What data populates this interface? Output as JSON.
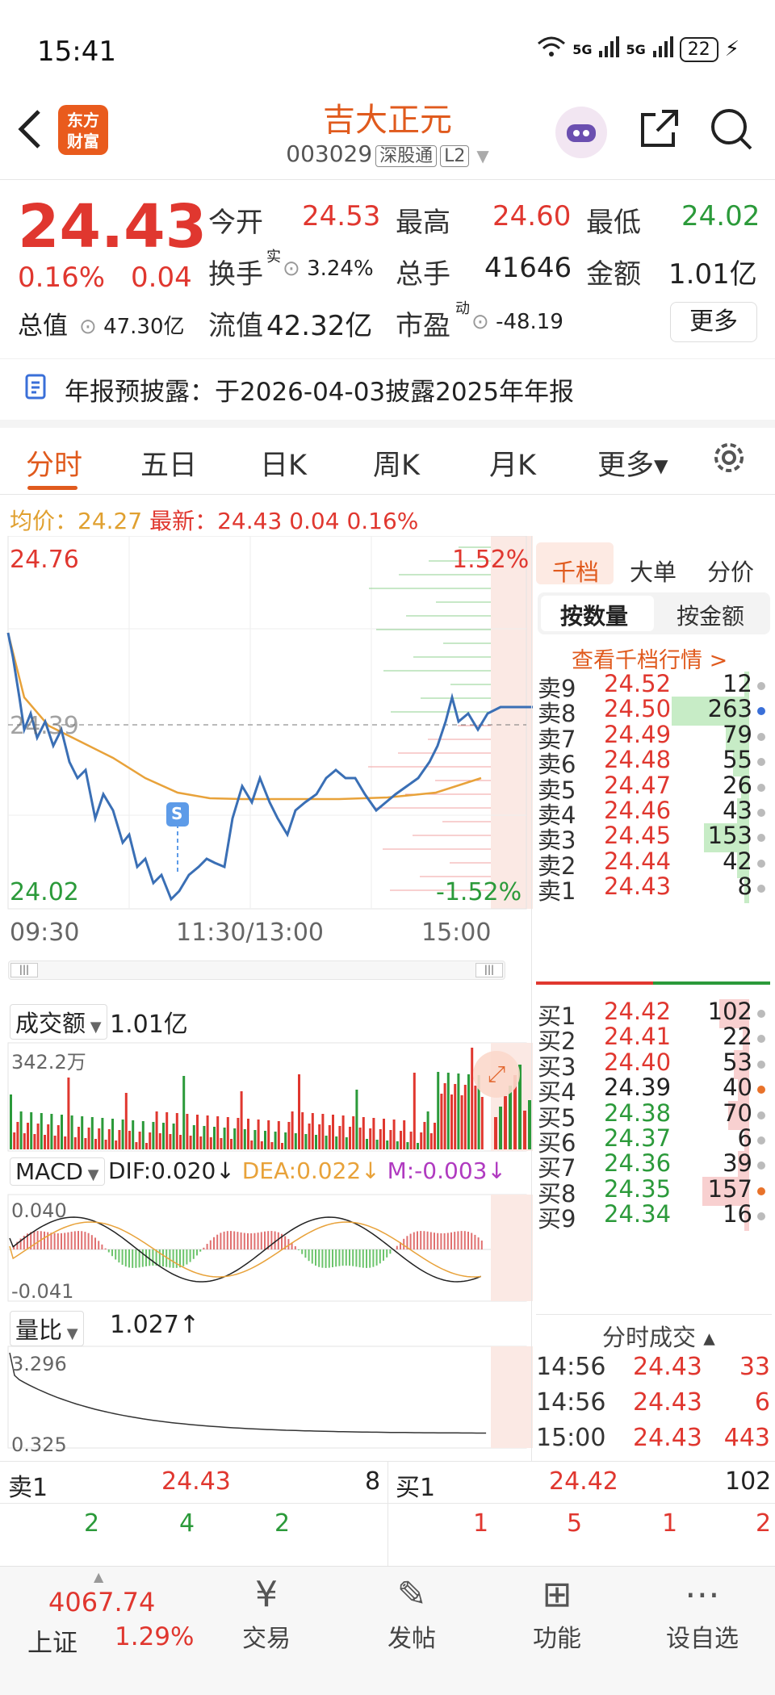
{
  "status": {
    "time": "15:41",
    "signal1": "5G",
    "signal2": "5G",
    "battery": "22"
  },
  "header": {
    "logo_line1": "东方",
    "logo_line2": "财富",
    "name": "吉大正元",
    "code": "003029",
    "tag1": "深股通",
    "tag2": "L2"
  },
  "quote": {
    "price": "24.43",
    "change_pct": "0.16%",
    "change": "0.04",
    "open_label": "今开",
    "open": "24.53",
    "high_label": "最高",
    "high": "24.60",
    "low_label": "最低",
    "low": "24.02",
    "turnover_label": "换手",
    "turnover_sup": "实",
    "turnover": "3.24%",
    "volume_label": "总手",
    "volume": "41646",
    "amount_label": "金额",
    "amount": "1.01亿",
    "mcap_label": "总值",
    "mcap": "47.30亿",
    "float_label": "流值",
    "float": "42.32亿",
    "pe_label": "市盈",
    "pe_sup": "动",
    "pe": "-48.19",
    "more": "更多"
  },
  "notice": "年报预披露：于2026-04-03披露2025年年报",
  "tabs": [
    "分时",
    "五日",
    "日K",
    "周K",
    "月K",
    "更多▾"
  ],
  "avg_line": {
    "avg_label": "均价：",
    "avg": "24.27",
    "last_label": "最新：",
    "last": "24.43",
    "chg": "0.04",
    "pct": "0.16%"
  },
  "intraday": {
    "y_top": "24.76",
    "y_mid": "24.39",
    "y_bottom": "24.02",
    "pct_top": "1.52%",
    "pct_bottom": "-1.52%",
    "x_labels": [
      "09:30",
      "11:30/13:00",
      "15:00"
    ],
    "marker": "S"
  },
  "volume_panel": {
    "selector": "成交额",
    "value": "1.01亿",
    "max_label": "342.2万"
  },
  "macd_panel": {
    "selector": "MACD",
    "dif": "DIF:0.020↓",
    "dea": "DEA:0.022↓",
    "m": "M:-0.003↓",
    "top": "0.040",
    "bottom": "-0.041"
  },
  "ratio_panel": {
    "selector": "量比",
    "value": "1.027↑",
    "top": "3.296",
    "bottom": "0.325"
  },
  "right_panel": {
    "tabs": [
      "千档",
      "大单",
      "分价"
    ],
    "subtabs": [
      "按数量",
      "按金额"
    ],
    "link": "查看千档行情 >",
    "asks": [
      {
        "label": "卖9",
        "price": "24.52",
        "vol": "12",
        "ratio": 0.05
      },
      {
        "label": "卖8",
        "price": "24.50",
        "vol": "263",
        "ratio": 1.0,
        "dot": "blue"
      },
      {
        "label": "卖7",
        "price": "24.49",
        "vol": "79",
        "ratio": 0.3
      },
      {
        "label": "卖6",
        "price": "24.48",
        "vol": "55",
        "ratio": 0.21
      },
      {
        "label": "卖5",
        "price": "24.47",
        "vol": "26",
        "ratio": 0.1
      },
      {
        "label": "卖4",
        "price": "24.46",
        "vol": "43",
        "ratio": 0.16
      },
      {
        "label": "卖3",
        "price": "24.45",
        "vol": "153",
        "ratio": 0.58
      },
      {
        "label": "卖2",
        "price": "24.44",
        "vol": "42",
        "ratio": 0.16
      },
      {
        "label": "卖1",
        "price": "24.43",
        "vol": "8",
        "ratio": 0.03
      }
    ],
    "bids": [
      {
        "label": "买1",
        "price": "24.42",
        "vol": "102",
        "ratio": 0.39
      },
      {
        "label": "买2",
        "price": "24.41",
        "vol": "22",
        "ratio": 0.08
      },
      {
        "label": "买3",
        "price": "24.40",
        "vol": "53",
        "ratio": 0.2
      },
      {
        "label": "买4",
        "price": "24.39",
        "vol": "40",
        "ratio": 0.15,
        "dot": "orange"
      },
      {
        "label": "买5",
        "price": "24.38",
        "vol": "70",
        "ratio": 0.27
      },
      {
        "label": "买6",
        "price": "24.37",
        "vol": "6",
        "ratio": 0.02
      },
      {
        "label": "买7",
        "price": "24.36",
        "vol": "39",
        "ratio": 0.15
      },
      {
        "label": "买8",
        "price": "24.35",
        "vol": "157",
        "ratio": 0.6,
        "dot": "orange"
      },
      {
        "label": "买9",
        "price": "24.34",
        "vol": "16",
        "ratio": 0.06
      }
    ],
    "ticks_title": "分时成交 ▴",
    "ticks": [
      {
        "time": "14:56",
        "price": "24.43",
        "vol": "33"
      },
      {
        "time": "14:56",
        "price": "24.43",
        "vol": "6"
      },
      {
        "time": "15:00",
        "price": "24.43",
        "vol": "443"
      }
    ]
  },
  "bottom_ob": {
    "left_label": "卖1",
    "left_price": "24.43",
    "left_vol": "8",
    "right_label": "买1",
    "right_price": "24.42",
    "right_vol": "102",
    "left_queue": [
      "2",
      "4",
      "2"
    ],
    "right_queue": [
      "1",
      "5",
      "1",
      "2"
    ]
  },
  "index": {
    "value": "4067.74",
    "name": "上证",
    "pct": "1.29%"
  },
  "bottom_nav": [
    {
      "label": "交易",
      "icon": "¥"
    },
    {
      "label": "发帖",
      "icon": "✎"
    },
    {
      "label": "功能",
      "icon": "⊞"
    },
    {
      "label": "设自选",
      "icon": "⋯"
    }
  ]
}
